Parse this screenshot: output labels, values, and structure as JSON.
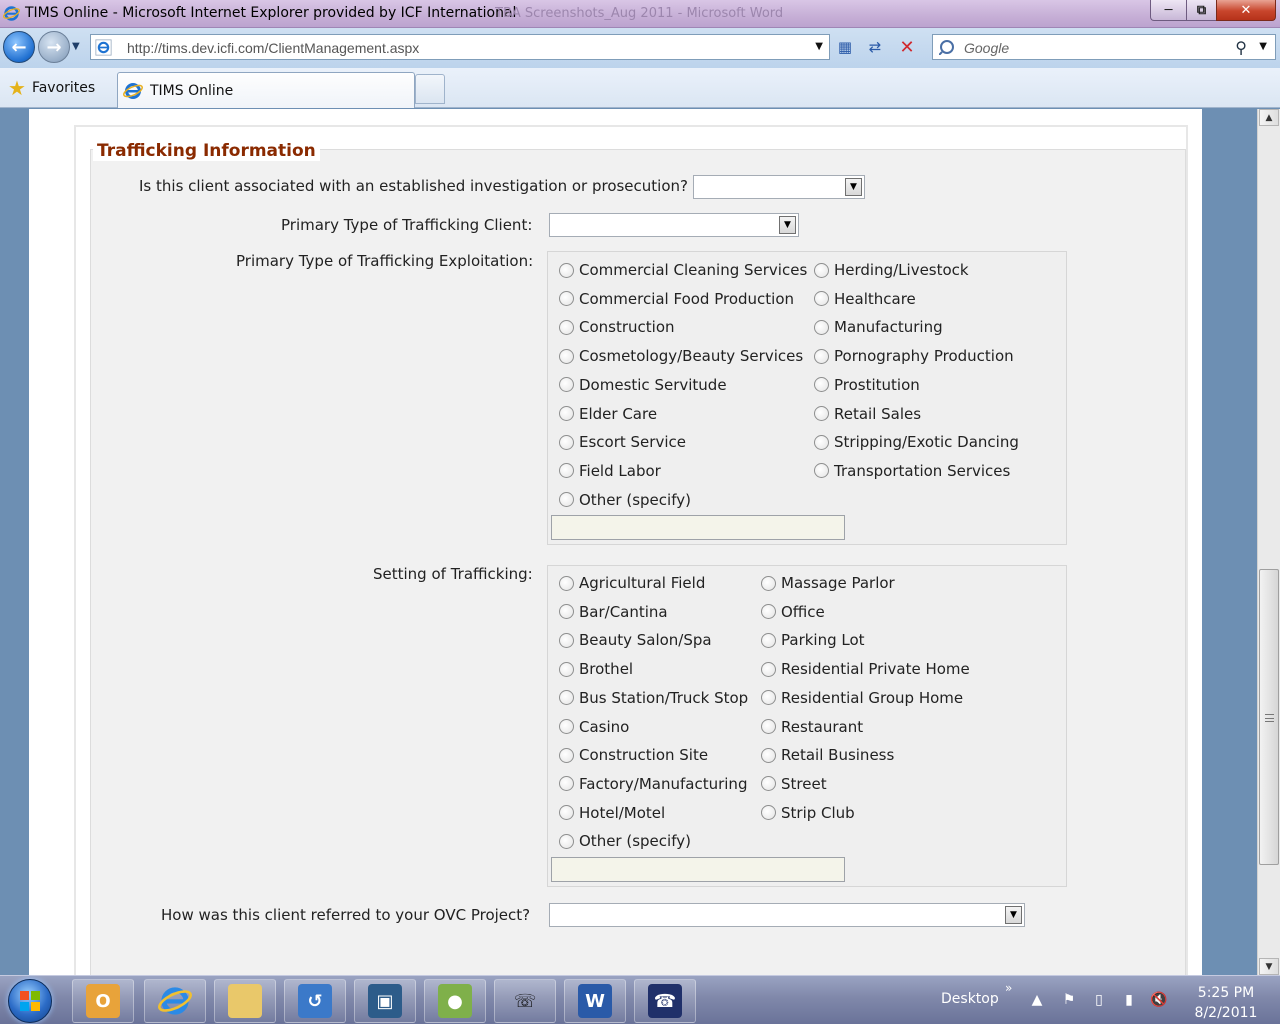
{
  "window": {
    "title": "TIMS Online - Microsoft Internet Explorer provided by ICF International",
    "background_title": "TBA Screenshots_Aug 2011 - Microsoft Word"
  },
  "address_bar": {
    "url": "http://tims.dev.icfi.com/ClientManagement.aspx",
    "search_placeholder": "Google"
  },
  "favorites_bar": {
    "favorites_label": "Favorites",
    "tab_title": "TIMS Online"
  },
  "form": {
    "section_title": "Trafficking Information",
    "investigation": {
      "label": "Is this client associated with an established investigation or prosecution?",
      "value": ""
    },
    "client_type": {
      "label": "Primary Type of Trafficking Client:",
      "value": ""
    },
    "exploitation": {
      "label": "Primary Type of Trafficking Exploitation:",
      "col1": [
        "Commercial Cleaning Services",
        "Commercial Food Production",
        "Construction",
        "Cosmetology/Beauty Services",
        "Domestic Servitude",
        "Elder Care",
        "Escort Service",
        "Field Labor",
        "Other (specify)"
      ],
      "col2": [
        "Herding/Livestock",
        "Healthcare",
        "Manufacturing",
        "Pornography Production",
        "Prostitution",
        "Retail Sales",
        "Stripping/Exotic Dancing",
        "Transportation Services"
      ],
      "other_value": ""
    },
    "setting": {
      "label": "Setting of Trafficking:",
      "col1": [
        "Agricultural Field",
        "Bar/Cantina",
        "Beauty Salon/Spa",
        "Brothel",
        "Bus Station/Truck Stop",
        "Casino",
        "Construction Site",
        "Factory/Manufacturing",
        "Hotel/Motel",
        "Other (specify)"
      ],
      "col2": [
        "Massage Parlor",
        "Office",
        "Parking Lot",
        "Residential Private Home",
        "Residential Group Home",
        "Restaurant",
        "Retail Business",
        "Street",
        "Strip Club"
      ],
      "other_value": ""
    },
    "referral": {
      "label": "How was this client referred to your OVC Project?",
      "value": ""
    }
  },
  "taskbar": {
    "desktop_label": "Desktop",
    "time": "5:25 PM",
    "date": "8/2/2011",
    "apps": [
      "outlook-icon",
      "internet-explorer-icon",
      "folder-icon",
      "remote-desktop-icon",
      "network-manager-icon",
      "security-icon",
      "phone-icon",
      "word-icon",
      "phone-dialer-icon"
    ]
  }
}
